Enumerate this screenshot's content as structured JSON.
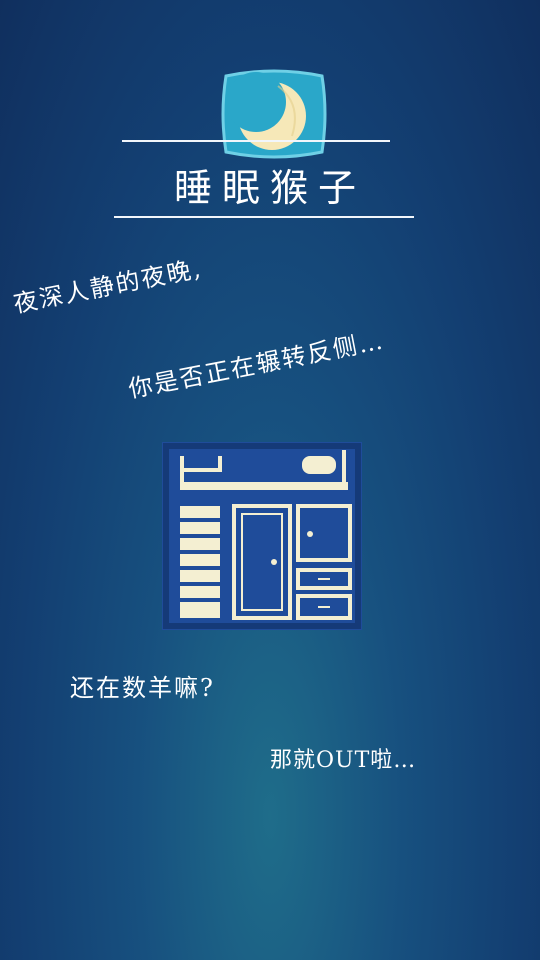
{
  "app": {
    "title": "睡眠猴子"
  },
  "slogans": {
    "line1": "夜深人静的夜晚,",
    "line2": "你是否正在辗转反侧…",
    "line3": "还在数羊嘛?",
    "line4": "那就OUT啦…"
  },
  "icons": {
    "logo": "moon-pillow-icon",
    "illustration": "loft-bed-icon"
  },
  "colors": {
    "background_top": "#102f5e",
    "background_glow": "#1f6d8a",
    "pillow": "#2aa7c9",
    "moon": "#f6e8b8",
    "bed_frame": "#1f4c9a",
    "bed_trim": "#f4efd2"
  }
}
